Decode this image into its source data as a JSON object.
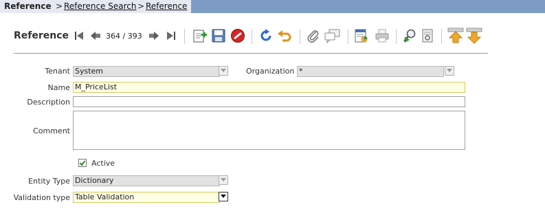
{
  "breadcrumb": {
    "current": "Reference",
    "sep1": ">",
    "link1": "Reference Search",
    "sep2": ">",
    "link2": "Reference"
  },
  "toolbar": {
    "title": "Reference",
    "record_counter": "364 / 393",
    "icons": [
      "first-record-icon",
      "previous-record-icon",
      "next-record-icon",
      "last-record-icon",
      "new-record-icon",
      "save-icon",
      "delete-icon",
      "refresh-icon",
      "undo-icon",
      "attachment-icon",
      "chat-icon",
      "report-icon",
      "print-icon",
      "zoom-across-icon",
      "archive-icon",
      "parent-record-icon",
      "detail-record-icon"
    ]
  },
  "form": {
    "tenant": {
      "label": "Tenant",
      "value": "System"
    },
    "organization": {
      "label": "Organization",
      "value": "*"
    },
    "name": {
      "label": "Name",
      "value": "M_PriceList"
    },
    "description": {
      "label": "Description",
      "value": ""
    },
    "comment": {
      "label": "Comment",
      "value": ""
    },
    "active": {
      "label": "Active",
      "checked": true
    },
    "entity_type": {
      "label": "Entity Type",
      "value": "Dictionary"
    },
    "validation_type": {
      "label": "Validation type",
      "value": "Table Validation"
    }
  },
  "colors": {
    "header_bar": "#7e9cc6",
    "crumb_bg": "#e4e9f2",
    "mandatory_field": "#ffffe6",
    "readonly_field": "#e2e2e2"
  }
}
